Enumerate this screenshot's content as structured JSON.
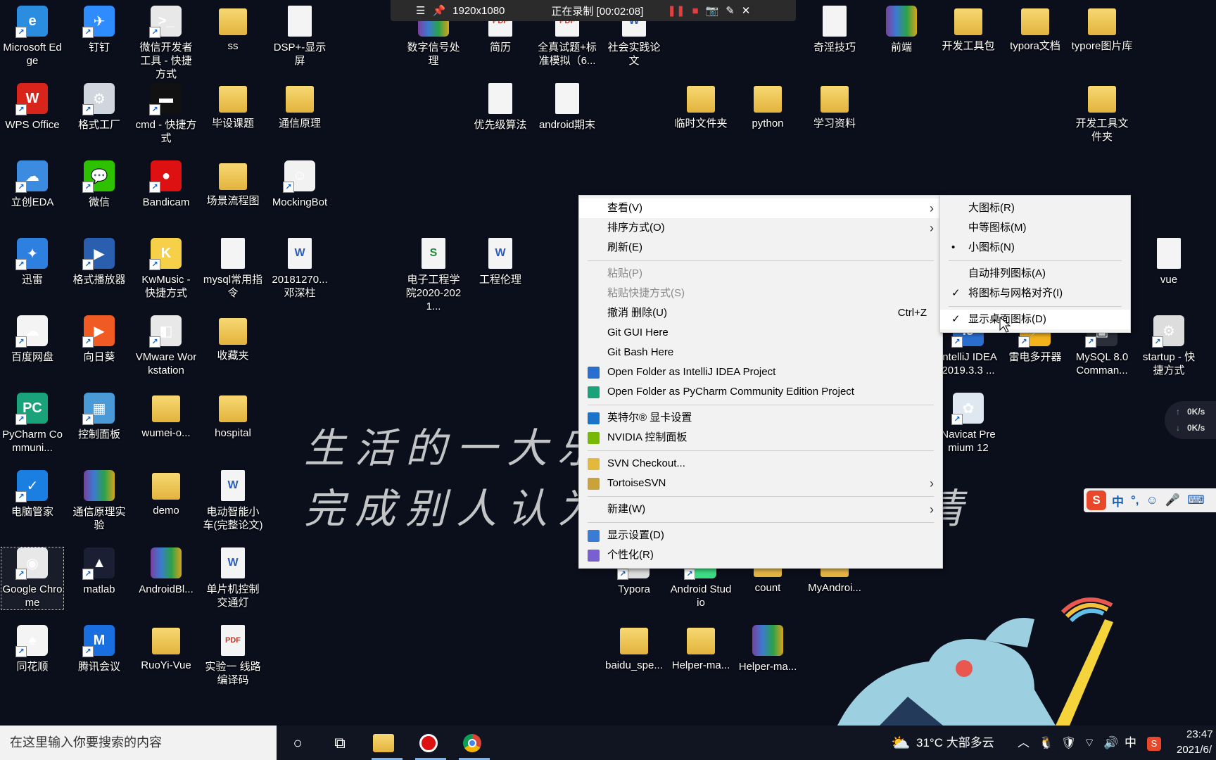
{
  "recorder": {
    "resolution": "1920x1080",
    "status": "正在录制 [00:02:08]"
  },
  "desktop_icons": [
    {
      "label": "Microsoft Edge",
      "icon": "edge-icon",
      "color": "#2a8de0",
      "sym": "e"
    },
    {
      "label": "钉钉",
      "icon": "dingtalk-icon",
      "color": "#2f8cff",
      "sym": "✈"
    },
    {
      "label": "微信开发者工具 - 快捷方式",
      "icon": "wechat-devtools-icon",
      "color": "#e8e8e8",
      "sym": ">_"
    },
    {
      "label": "ss",
      "icon": "folder-icon"
    },
    {
      "label": "DSP+-显示屏",
      "icon": "file-icon"
    },
    {
      "label": "数字信号处理",
      "icon": "archive-icon"
    },
    {
      "label": "简历",
      "icon": "pdf-icon"
    },
    {
      "label": "全真试题+标准模拟（6...",
      "icon": "pdf-icon"
    },
    {
      "label": "社会实践论文",
      "icon": "doc-icon"
    },
    {
      "label": "奇淫技巧",
      "icon": "file-icon"
    },
    {
      "label": "前端",
      "icon": "archive-icon"
    },
    {
      "label": "开发工具包",
      "icon": "folder-icon"
    },
    {
      "label": "typora文档",
      "icon": "folder-icon"
    },
    {
      "label": "typore图片库",
      "icon": "folder-icon"
    },
    {
      "label": "WPS Office",
      "icon": "wps-icon",
      "color": "#d9241b",
      "sym": "W"
    },
    {
      "label": "格式工厂",
      "icon": "format-factory-icon",
      "color": "#cfd6dd",
      "sym": "⚙"
    },
    {
      "label": "cmd - 快捷方式",
      "icon": "cmd-icon",
      "color": "#111",
      "sym": "▬"
    },
    {
      "label": "毕设课题",
      "icon": "folder-icon"
    },
    {
      "label": "通信原理",
      "icon": "folder-icon"
    },
    {
      "label": "优先级算法",
      "icon": "file-icon"
    },
    {
      "label": "android期末",
      "icon": "file-icon"
    },
    {
      "label": "临时文件夹",
      "icon": "folder-icon"
    },
    {
      "label": "python",
      "icon": "folder-icon"
    },
    {
      "label": "学习资料",
      "icon": "folder-icon"
    },
    {
      "label": "开发工具文件夹",
      "icon": "folder-icon"
    },
    {
      "label": "立创EDA",
      "icon": "lceda-icon",
      "color": "#3b8be0",
      "sym": "☁"
    },
    {
      "label": "微信",
      "icon": "wechat-icon",
      "color": "#2dc100",
      "sym": "💬"
    },
    {
      "label": "Bandicam",
      "icon": "bandicam-icon",
      "color": "#d11",
      "sym": "●"
    },
    {
      "label": "场景流程图",
      "icon": "folder-icon"
    },
    {
      "label": "MockingBot",
      "icon": "mockingbot-icon",
      "color": "#f2f2f2",
      "sym": "☺"
    },
    {
      "label": "迅雷",
      "icon": "thunder-icon",
      "color": "#2d7fe0",
      "sym": "✦"
    },
    {
      "label": "格式播放器",
      "icon": "player-icon",
      "color": "#2a5fb0",
      "sym": "▶"
    },
    {
      "label": "KwMusic - 快捷方式",
      "icon": "kwmusic-icon",
      "color": "#f7d04a",
      "sym": "K"
    },
    {
      "label": "mysql常用指令",
      "icon": "file-icon"
    },
    {
      "label": "20181270...邓深柱",
      "icon": "doc-icon"
    },
    {
      "label": "电子工程学院2020-2021...",
      "icon": "xls-icon"
    },
    {
      "label": "工程伦理",
      "icon": "doc-icon"
    },
    {
      "label": "vue",
      "icon": "file-icon"
    },
    {
      "label": "百度网盘",
      "icon": "baidu-netdisk-icon",
      "color": "#f4f4f4",
      "sym": "☁"
    },
    {
      "label": "向日葵",
      "icon": "sunflower-icon",
      "color": "#f05a23",
      "sym": "▶"
    },
    {
      "label": "VMware Workstation",
      "icon": "vmware-icon",
      "color": "#e8e8e8",
      "sym": "◧"
    },
    {
      "label": "收藏夹",
      "icon": "folder-icon"
    },
    {
      "label": "IntelliJ IDEA 2019.3.3 ...",
      "icon": "intellij-icon",
      "color": "#2a6fd0",
      "sym": "IJ"
    },
    {
      "label": "雷电多开器",
      "icon": "ldmultiplayer-icon",
      "color": "#f3b31a",
      "sym": "⚡"
    },
    {
      "label": "MySQL 8.0 Comman...",
      "icon": "mysql-icon",
      "color": "#2a2f3a",
      "sym": "▣"
    },
    {
      "label": "startup - 快捷方式",
      "icon": "startup-icon",
      "color": "#ddd",
      "sym": "⚙"
    },
    {
      "label": "PyCharm Communi...",
      "icon": "pycharm-icon",
      "color": "#1aa37a",
      "sym": "PC"
    },
    {
      "label": "控制面板",
      "icon": "control-panel-icon",
      "color": "#4a9ad8",
      "sym": "▦"
    },
    {
      "label": "wumei-o...",
      "icon": "folder-icon"
    },
    {
      "label": "hospital",
      "icon": "folder-icon"
    },
    {
      "label": "Navicat Premium 12",
      "icon": "navicat-icon",
      "color": "#dfe8f0",
      "sym": "✿"
    },
    {
      "label": "电脑管家",
      "icon": "pc-manager-icon",
      "color": "#1a7fe0",
      "sym": "✓"
    },
    {
      "label": "通信原理实验",
      "icon": "archive-icon"
    },
    {
      "label": "demo",
      "icon": "folder-icon"
    },
    {
      "label": "电动智能小车(完整论文)",
      "icon": "doc-icon"
    },
    {
      "label": "Google Chrome",
      "icon": "chrome-icon",
      "color": "#e8e8e8",
      "sym": "◉"
    },
    {
      "label": "matlab",
      "icon": "matlab-icon",
      "color": "#1a1f33",
      "sym": "▲"
    },
    {
      "label": "AndroidBl...",
      "icon": "archive-icon"
    },
    {
      "label": "单片机控制交通灯",
      "icon": "doc-icon"
    },
    {
      "label": "Typora",
      "icon": "typora-icon",
      "color": "#ddd",
      "sym": "T"
    },
    {
      "label": "Android Studio",
      "icon": "android-studio-icon",
      "color": "#3ddc84",
      "sym": "A"
    },
    {
      "label": "count",
      "icon": "folder-icon"
    },
    {
      "label": "MyAndroi...",
      "icon": "folder-icon"
    },
    {
      "label": "同花顺",
      "icon": "tonghuashun-icon",
      "color": "#f4f4f4",
      "sym": "♠"
    },
    {
      "label": "腾讯会议",
      "icon": "tencent-meeting-icon",
      "color": "#1a6fe0",
      "sym": "M"
    },
    {
      "label": "RuoYi-Vue",
      "icon": "folder-icon"
    },
    {
      "label": "实验一 线路编译码",
      "icon": "pdf-icon"
    },
    {
      "label": "baidu_spe...",
      "icon": "folder-icon"
    },
    {
      "label": "Helper-ma...",
      "icon": "folder-icon"
    },
    {
      "label": "Helper-ma...",
      "icon": "archive-icon"
    }
  ],
  "wallpaper": {
    "line1": "生活的一大乐",
    "line2": "完成别人认为",
    "line2_tail": "情"
  },
  "context_menu": {
    "items": [
      {
        "label": "查看(V)",
        "submenu": true
      },
      {
        "label": "排序方式(O)",
        "submenu": true
      },
      {
        "label": "刷新(E)"
      },
      {
        "sep": true
      },
      {
        "label": "粘贴(P)",
        "disabled": true
      },
      {
        "label": "粘贴快捷方式(S)",
        "disabled": true
      },
      {
        "label": "撤消 删除(U)",
        "shortcut": "Ctrl+Z"
      },
      {
        "label": "Git GUI Here"
      },
      {
        "label": "Git Bash Here"
      },
      {
        "label": "Open Folder as IntelliJ IDEA Project",
        "icon": "intellij-icon",
        "icolor": "#2a6fd0"
      },
      {
        "label": "Open Folder as PyCharm Community Edition Project",
        "icon": "pycharm-icon",
        "icolor": "#1aa37a"
      },
      {
        "sep": true
      },
      {
        "label": "英特尔® 显卡设置",
        "icon": "intel-graphics-icon",
        "icolor": "#1a73c8"
      },
      {
        "label": "NVIDIA 控制面板",
        "icon": "nvidia-icon",
        "icolor": "#76b900"
      },
      {
        "sep": true
      },
      {
        "label": "SVN Checkout...",
        "icon": "svn-checkout-icon",
        "icolor": "#e2b93b"
      },
      {
        "label": "TortoiseSVN",
        "icon": "tortoisesvn-icon",
        "icolor": "#c9a23a",
        "submenu": true
      },
      {
        "sep": true
      },
      {
        "label": "新建(W)",
        "submenu": true
      },
      {
        "sep": true
      },
      {
        "label": "显示设置(D)",
        "icon": "display-settings-icon",
        "icolor": "#3a7bd5"
      },
      {
        "label": "个性化(R)",
        "icon": "personalize-icon",
        "icolor": "#7a5fd0"
      }
    ]
  },
  "view_submenu": {
    "items": [
      {
        "label": "大图标(R)"
      },
      {
        "label": "中等图标(M)"
      },
      {
        "label": "小图标(N)",
        "mark": "•"
      },
      {
        "sep": true
      },
      {
        "label": "自动排列图标(A)"
      },
      {
        "label": "将图标与网格对齐(I)",
        "mark": "✓"
      },
      {
        "sep": true
      },
      {
        "label": "显示桌面图标(D)",
        "mark": "✓",
        "highlight": true
      }
    ]
  },
  "net_speed": {
    "up": "0K/s",
    "down": "0K/s"
  },
  "ime": {
    "label": "中"
  },
  "taskbar": {
    "search_placeholder": "在这里输入你要搜索的内容",
    "weather": "31°C 大部多云",
    "ime": "中",
    "time": "23:47",
    "date": "2021/6/"
  }
}
